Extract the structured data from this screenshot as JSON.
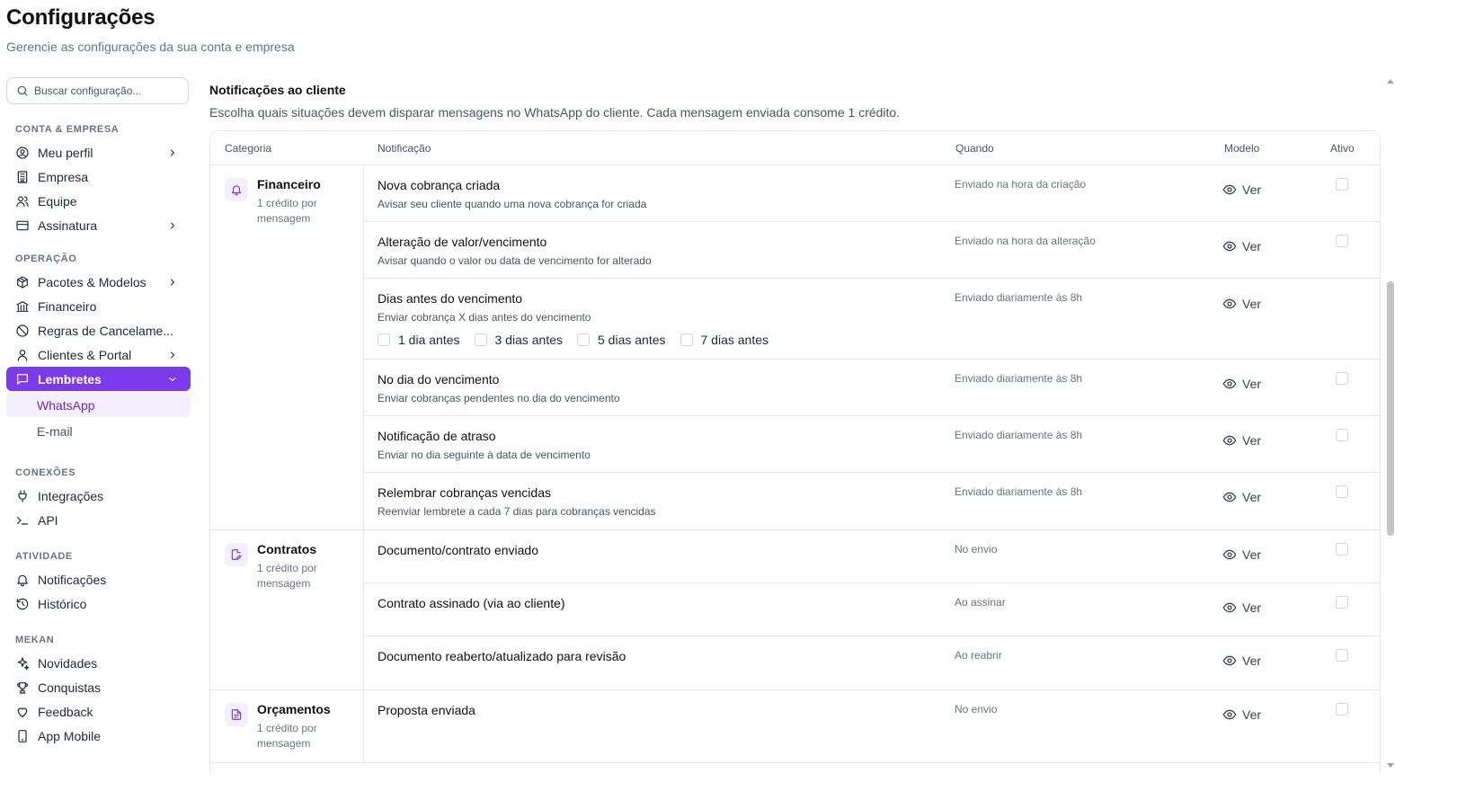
{
  "page": {
    "title": "Configurações",
    "subtitle": "Gerencie as configurações da sua conta e empresa"
  },
  "sidebar": {
    "search_placeholder": "Buscar configuração...",
    "sections": [
      {
        "title": "CONTA & EMPRESA",
        "items": [
          {
            "label": "Meu perfil",
            "icon": "user-circle-icon",
            "chevron": "right"
          },
          {
            "label": "Empresa",
            "icon": "building-icon"
          },
          {
            "label": "Equipe",
            "icon": "users-icon"
          },
          {
            "label": "Assinatura",
            "icon": "credit-card-icon",
            "chevron": "right"
          }
        ]
      },
      {
        "title": "OPERAÇÃO",
        "items": [
          {
            "label": "Pacotes & Modelos",
            "icon": "package-icon",
            "chevron": "right"
          },
          {
            "label": "Financeiro",
            "icon": "bank-icon"
          },
          {
            "label": "Regras de Cancelame...",
            "icon": "ban-icon"
          },
          {
            "label": "Clientes & Portal",
            "icon": "user-icon",
            "chevron": "right"
          },
          {
            "label": "Lembretes",
            "icon": "message-square-icon",
            "chevron": "down",
            "active": true,
            "children": [
              {
                "label": "WhatsApp",
                "selected": true
              },
              {
                "label": "E-mail"
              }
            ]
          }
        ]
      },
      {
        "title": "CONEXÕES",
        "items": [
          {
            "label": "Integrações",
            "icon": "plug-icon"
          },
          {
            "label": "API",
            "icon": "terminal-icon"
          }
        ]
      },
      {
        "title": "ATIVIDADE",
        "items": [
          {
            "label": "Notificações",
            "icon": "bell-icon"
          },
          {
            "label": "Histórico",
            "icon": "history-icon"
          }
        ]
      },
      {
        "title": "MEKAN",
        "items": [
          {
            "label": "Novidades",
            "icon": "sparkles-icon"
          },
          {
            "label": "Conquistas",
            "icon": "trophy-icon"
          },
          {
            "label": "Feedback",
            "icon": "heart-icon"
          },
          {
            "label": "App Mobile",
            "icon": "smartphone-icon"
          }
        ]
      }
    ]
  },
  "main": {
    "title": "Notificações ao cliente",
    "description": "Escolha quais situações devem disparar mensagens no WhatsApp do cliente. Cada mensagem enviada consome 1 crédito.",
    "columns": {
      "category": "Categoria",
      "notification": "Notificação",
      "when": "Quando",
      "model": "Modelo",
      "active": "Ativo"
    },
    "view_label": "Ver",
    "groups": [
      {
        "name": "Financeiro",
        "desc": "1 crédito por mensagem",
        "icon": "bell-icon",
        "rows": [
          {
            "title": "Nova cobrança criada",
            "desc": "Avisar seu cliente quando uma nova cobrança for criada",
            "when": "Enviado na hora da criação",
            "checkbox": true,
            "h": 63
          },
          {
            "title": "Alteração de valor/vencimento",
            "desc": "Avisar quando o valor ou data de vencimento for alterado",
            "when": "Enviado na hora da alteração",
            "checkbox": true,
            "h": 63
          },
          {
            "title": "Dias antes do vencimento",
            "desc": "Enviar cobrança X dias antes do vencimento",
            "when": "Enviado diariamente às 8h",
            "checkbox": false,
            "h": 90,
            "options": [
              "1 dia antes",
              "3 dias antes",
              "5 dias antes",
              "7 dias antes"
            ]
          },
          {
            "title": "No dia do vencimento",
            "desc": "Enviar cobranças pendentes no dia do vencimento",
            "when": "Enviado diariamente às 8h",
            "checkbox": true,
            "h": 63
          },
          {
            "title": "Notificação de atraso",
            "desc": "Enviar no dia seguinte à data de vencimento",
            "when": "Enviado diariamente às 8h",
            "checkbox": true,
            "h": 63
          },
          {
            "title": "Relembrar cobranças vencidas",
            "desc": "Reenviar lembrete a cada 7 dias para cobranças vencidas",
            "when": "Enviado diariamente às 8h",
            "checkbox": true,
            "h": 63
          }
        ]
      },
      {
        "name": "Contratos",
        "desc": "1 crédito por mensagem",
        "icon": "file-edit-icon",
        "rows": [
          {
            "title": "Documento/contrato enviado",
            "desc": "",
            "when": "No envio",
            "checkbox": true,
            "h": 59
          },
          {
            "title": "Contrato assinado (via ao cliente)",
            "desc": "",
            "when": "Ao assinar",
            "checkbox": true,
            "h": 59
          },
          {
            "title": "Documento reaberto/atualizado para revisão",
            "desc": "",
            "when": "Ao reabrir",
            "checkbox": true,
            "h": 59
          }
        ]
      },
      {
        "name": "Orçamentos",
        "desc": "1 crédito por mensagem",
        "icon": "file-text-icon",
        "rows": [
          {
            "title": "Proposta enviada",
            "desc": "",
            "when": "No envio",
            "checkbox": true,
            "h": 80
          }
        ]
      }
    ]
  },
  "colors": {
    "accent": "#7c3aed",
    "accent_soft": "#f3effd",
    "border": "#e5e7eb",
    "muted_text": "#6b7280"
  }
}
